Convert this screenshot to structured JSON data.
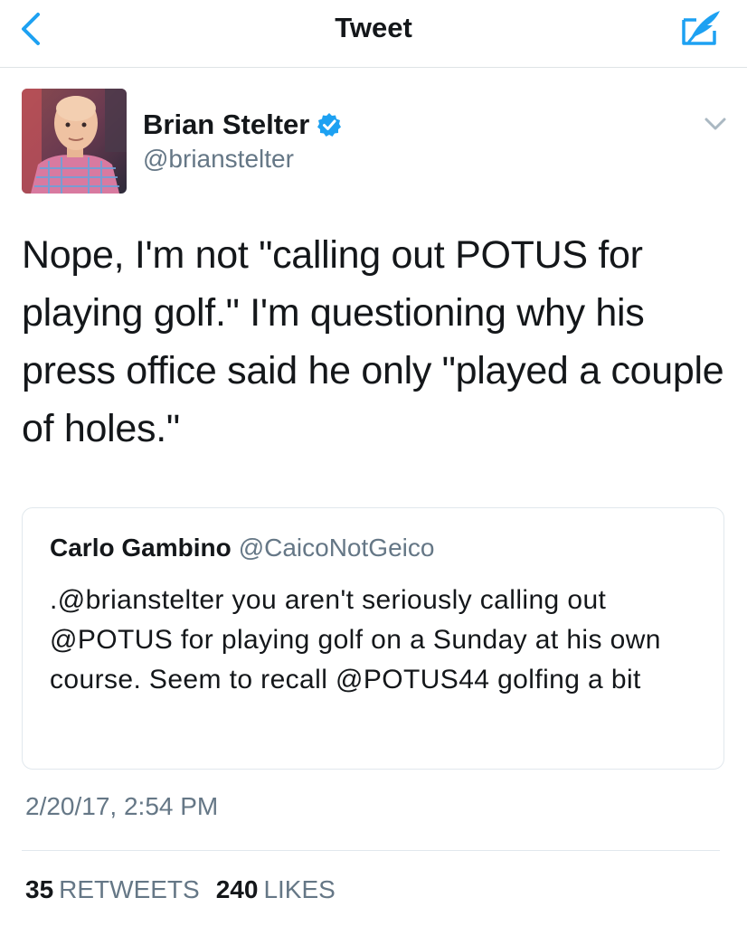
{
  "navbar": {
    "title": "Tweet",
    "back_icon": "chevron-left-icon",
    "compose_icon": "compose-quill-icon",
    "accent_color": "#1da1f2"
  },
  "author": {
    "name": "Brian Stelter",
    "handle": "@brianstelter",
    "verified": true,
    "verified_color": "#1da1f2"
  },
  "tweet": {
    "text": "Nope, I'm not \"calling out POTUS for playing golf.\" I'm questioning why his press office said he only \"played a couple of holes.\"",
    "timestamp": "2/20/17, 2:54 PM"
  },
  "quoted_tweet": {
    "name": "Carlo Gambino",
    "handle": "@CaicoNotGeico",
    "text": ".@brianstelter you aren't seriously calling out @POTUS for playing golf on a Sunday at his own course. Seem to recall @POTUS44 golfing a bit"
  },
  "stats": {
    "retweets_count": "35",
    "retweets_label": "RETWEETS",
    "likes_count": "240",
    "likes_label": "LIKES"
  }
}
